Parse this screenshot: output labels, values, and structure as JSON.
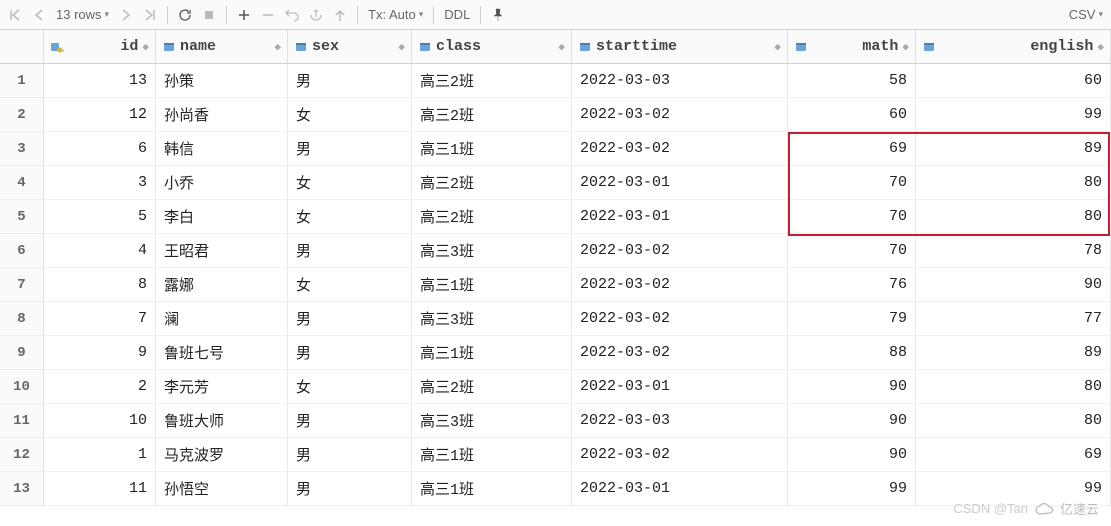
{
  "toolbar": {
    "rows_label": "13 rows",
    "tx_label": "Tx: Auto",
    "ddl_label": "DDL",
    "export_label": "CSV"
  },
  "columns": [
    {
      "key": "id",
      "label": "id",
      "numeric": true,
      "pk": true
    },
    {
      "key": "name",
      "label": "name",
      "numeric": false,
      "pk": false
    },
    {
      "key": "sex",
      "label": "sex",
      "numeric": false,
      "pk": false
    },
    {
      "key": "class",
      "label": "class",
      "numeric": false,
      "pk": false
    },
    {
      "key": "starttime",
      "label": "starttime",
      "numeric": false,
      "pk": false
    },
    {
      "key": "math",
      "label": "math",
      "numeric": true,
      "pk": false
    },
    {
      "key": "english",
      "label": "english",
      "numeric": true,
      "pk": false
    }
  ],
  "rows": [
    {
      "id": 13,
      "name": "孙策",
      "sex": "男",
      "class": "高三2班",
      "starttime": "2022-03-03",
      "math": 58,
      "english": 60
    },
    {
      "id": 12,
      "name": "孙尚香",
      "sex": "女",
      "class": "高三2班",
      "starttime": "2022-03-02",
      "math": 60,
      "english": 99
    },
    {
      "id": 6,
      "name": "韩信",
      "sex": "男",
      "class": "高三1班",
      "starttime": "2022-03-02",
      "math": 69,
      "english": 89
    },
    {
      "id": 3,
      "name": "小乔",
      "sex": "女",
      "class": "高三2班",
      "starttime": "2022-03-01",
      "math": 70,
      "english": 80
    },
    {
      "id": 5,
      "name": "李白",
      "sex": "女",
      "class": "高三2班",
      "starttime": "2022-03-01",
      "math": 70,
      "english": 80
    },
    {
      "id": 4,
      "name": "王昭君",
      "sex": "男",
      "class": "高三3班",
      "starttime": "2022-03-02",
      "math": 70,
      "english": 78
    },
    {
      "id": 8,
      "name": "露娜",
      "sex": "女",
      "class": "高三1班",
      "starttime": "2022-03-02",
      "math": 76,
      "english": 90
    },
    {
      "id": 7,
      "name": "澜",
      "sex": "男",
      "class": "高三3班",
      "starttime": "2022-03-02",
      "math": 79,
      "english": 77
    },
    {
      "id": 9,
      "name": "鲁班七号",
      "sex": "男",
      "class": "高三1班",
      "starttime": "2022-03-02",
      "math": 88,
      "english": 89
    },
    {
      "id": 2,
      "name": "李元芳",
      "sex": "女",
      "class": "高三2班",
      "starttime": "2022-03-01",
      "math": 90,
      "english": 80
    },
    {
      "id": 10,
      "name": "鲁班大师",
      "sex": "男",
      "class": "高三3班",
      "starttime": "2022-03-03",
      "math": 90,
      "english": 80
    },
    {
      "id": 1,
      "name": "马克波罗",
      "sex": "男",
      "class": "高三1班",
      "starttime": "2022-03-02",
      "math": 90,
      "english": 69
    },
    {
      "id": 11,
      "name": "孙悟空",
      "sex": "男",
      "class": "高三1班",
      "starttime": "2022-03-01",
      "math": 99,
      "english": 99
    }
  ],
  "watermark": {
    "left": "CSDN @Tan",
    "right": "亿速云"
  }
}
